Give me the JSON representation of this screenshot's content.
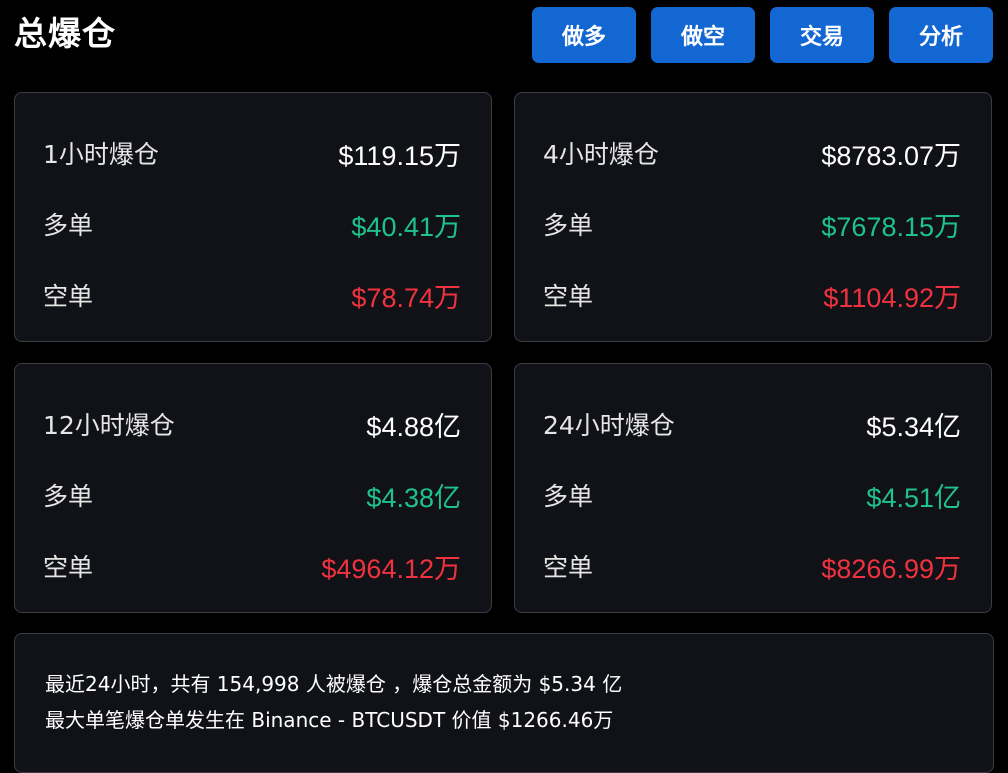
{
  "header": {
    "title": "总爆仓",
    "buttons": {
      "long": "做多",
      "short": "做空",
      "trade": "交易",
      "analysis": "分析"
    }
  },
  "cards": {
    "h1": {
      "label": "1小时爆仓",
      "total": "$119.15万",
      "long_label": "多单",
      "long": "$40.41万",
      "short_label": "空单",
      "short": "$78.74万"
    },
    "h4": {
      "label": "4小时爆仓",
      "total": "$8783.07万",
      "long_label": "多单",
      "long": "$7678.15万",
      "short_label": "空单",
      "short": "$1104.92万"
    },
    "h12": {
      "label": "12小时爆仓",
      "total": "$4.88亿",
      "long_label": "多单",
      "long": "$4.38亿",
      "short_label": "空单",
      "short": "$4964.12万"
    },
    "h24": {
      "label": "24小时爆仓",
      "total": "$5.34亿",
      "long_label": "多单",
      "long": "$4.51亿",
      "short_label": "空单",
      "short": "$8266.99万"
    }
  },
  "summary": {
    "line1": "最近24小时，共有 154,998 人被爆仓 ，爆仓总金额为 $5.34 亿",
    "line2": "最大单笔爆仓单发生在 Binance - BTCUSDT 价值 $1266.46万"
  },
  "colors": {
    "background": "#000000",
    "card": "#101217",
    "button": "#1267d3",
    "long": "#1fc28a",
    "short": "#f0323f"
  }
}
